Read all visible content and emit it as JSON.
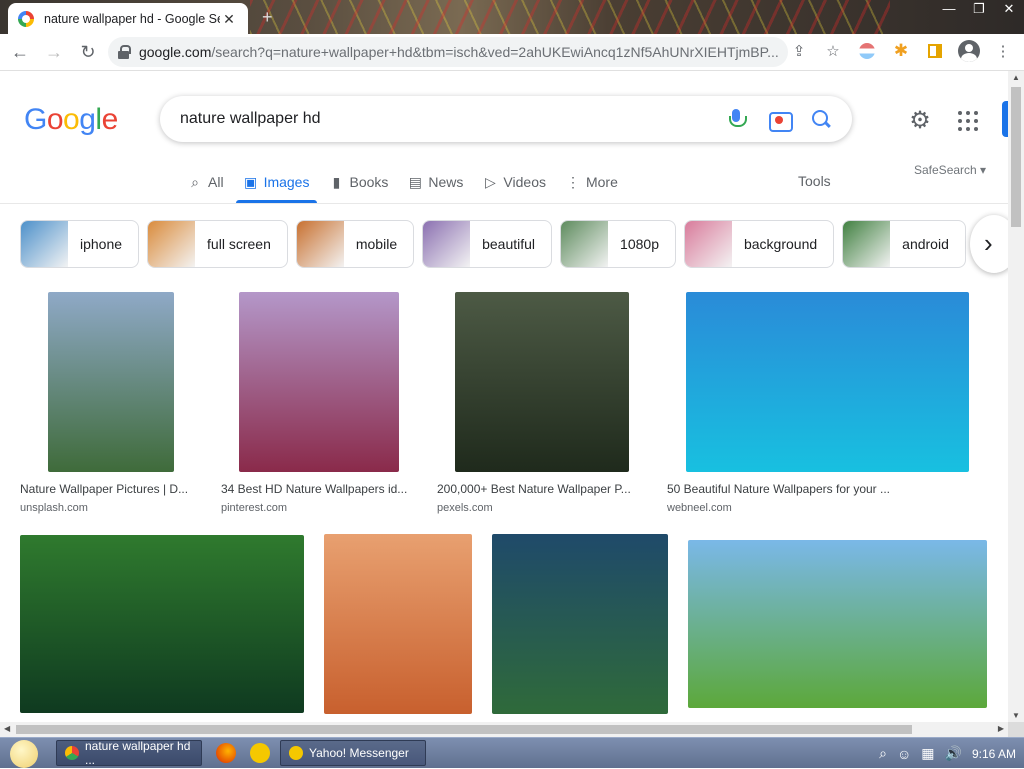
{
  "browser": {
    "tab_title": "nature wallpaper hd - Google Se",
    "tab_close": "✕",
    "new_tab": "+",
    "window_buttons": [
      "—",
      "❐",
      "✕"
    ],
    "url_domain": "google.com",
    "url_path": "/search?q=nature+wallpaper+hd&tbm=isch&ved=2ahUKEwiAncq1zNf5AhUNrXIEHTjmBP...",
    "nav": {
      "back": "←",
      "forward": "→",
      "reload": "↻"
    },
    "share_icon": "⇪",
    "star_icon": "☆",
    "puzzle_icon": "✱",
    "menu_icon": "⋮"
  },
  "google": {
    "logo_letters": [
      "G",
      "o",
      "o",
      "g",
      "l",
      "e"
    ],
    "query": "nature wallpaper hd",
    "gear_icon": "⚙",
    "tabs": [
      {
        "icon": "⌕",
        "label": "All"
      },
      {
        "icon": "▣",
        "label": "Images"
      },
      {
        "icon": "▮",
        "label": "Books"
      },
      {
        "icon": "▤",
        "label": "News"
      },
      {
        "icon": "▷",
        "label": "Videos"
      },
      {
        "icon": "⋮",
        "label": "More"
      }
    ],
    "tools": "Tools",
    "safesearch": "SafeSearch ▾",
    "chips": [
      {
        "label": "iphone",
        "color": "#4b8fc9"
      },
      {
        "label": "full screen",
        "color": "#d98a3a"
      },
      {
        "label": "mobile",
        "color": "#c76f2e"
      },
      {
        "label": "beautiful",
        "color": "#8a6fb0"
      },
      {
        "label": "1080p",
        "color": "#5c8a5c"
      },
      {
        "label": "background",
        "color": "#d87a9a"
      },
      {
        "label": "android",
        "color": "#3f7f3f"
      }
    ],
    "chip_next": "›",
    "results_row1": [
      {
        "caption": "Nature Wallpaper Pictures | D...",
        "source": "unsplash.com",
        "colors": [
          "#8fa9c7",
          "#3f6b3a"
        ]
      },
      {
        "caption": "34 Best HD Nature Wallpapers id...",
        "source": "pinterest.com",
        "colors": [
          "#b497c9",
          "#8a2a4a"
        ]
      },
      {
        "caption": "200,000+ Best Nature Wallpaper P...",
        "source": "pexels.com",
        "colors": [
          "#4d5a45",
          "#1f2a1c"
        ]
      },
      {
        "caption": "50 Beautiful Nature Wallpapers for your ...",
        "source": "webneel.com",
        "colors": [
          "#2a8bd8",
          "#18c0e0"
        ]
      }
    ],
    "results_row2": [
      {
        "colors": [
          "#2f7a2e",
          "#0f3a20"
        ]
      },
      {
        "colors": [
          "#e8a070",
          "#c8602e"
        ]
      },
      {
        "colors": [
          "#1f4a6a",
          "#2f6a3a"
        ]
      },
      {
        "colors": [
          "#7ab8e8",
          "#5ca83a"
        ]
      }
    ]
  },
  "taskbar": {
    "items": [
      {
        "label": "nature wallpaper hd ..."
      },
      {
        "label": "Yahoo! Messenger"
      }
    ],
    "clock": "9:16 AM",
    "tray_icons": [
      "⌕",
      "☺",
      "▦",
      "🔊"
    ]
  }
}
